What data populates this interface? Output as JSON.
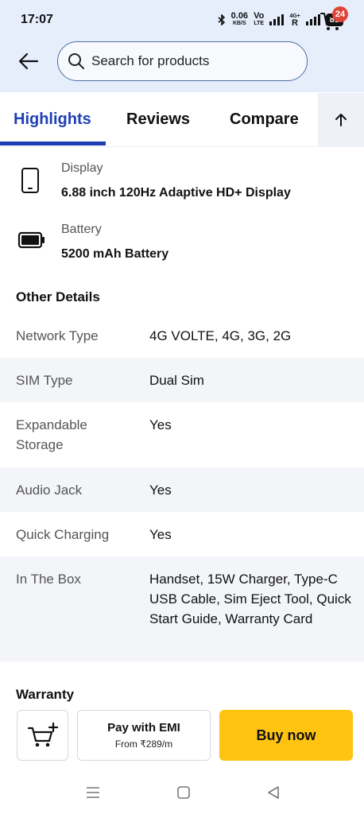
{
  "status_bar": {
    "time": "17:07",
    "net_speed_value": "0.06",
    "net_speed_unit": "KB/S",
    "volte_top": "Vo",
    "volte_bottom": "LTE",
    "network_top": "4G+",
    "network_bottom": "R",
    "battery": "81"
  },
  "header": {
    "search_placeholder": "Search for products",
    "cart_count": "24"
  },
  "tabs": [
    {
      "label": "Highlights",
      "active": true
    },
    {
      "label": "Reviews",
      "active": false
    },
    {
      "label": "Compare",
      "active": false
    }
  ],
  "highlights": [
    {
      "icon": "phone-icon",
      "label": "Display",
      "value": "6.88 inch 120Hz Adaptive HD+ Display"
    },
    {
      "icon": "battery-icon",
      "label": "Battery",
      "value": "5200 mAh Battery"
    }
  ],
  "other_details": {
    "title": "Other Details",
    "rows": [
      {
        "key": "Network Type",
        "value": "4G VOLTE, 4G, 3G, 2G"
      },
      {
        "key": "SIM Type",
        "value": "Dual Sim"
      },
      {
        "key": "Expandable Storage",
        "value": "Yes"
      },
      {
        "key": "Audio Jack",
        "value": "Yes"
      },
      {
        "key": "Quick Charging",
        "value": "Yes"
      },
      {
        "key": "In The Box",
        "value": "Handset, 15W Charger, Type-C USB Cable, Sim Eject Tool, Quick Start Guide, Warranty Card"
      }
    ]
  },
  "warranty_title": "Warranty",
  "actions": {
    "emi_title": "Pay with EMI",
    "emi_sub": "From ₹289/m",
    "buy_label": "Buy now"
  },
  "colors": {
    "accent": "#1f3fb5",
    "header_bg": "#e6eefc",
    "buy_button": "#ffc312",
    "badge": "#e0453a"
  }
}
